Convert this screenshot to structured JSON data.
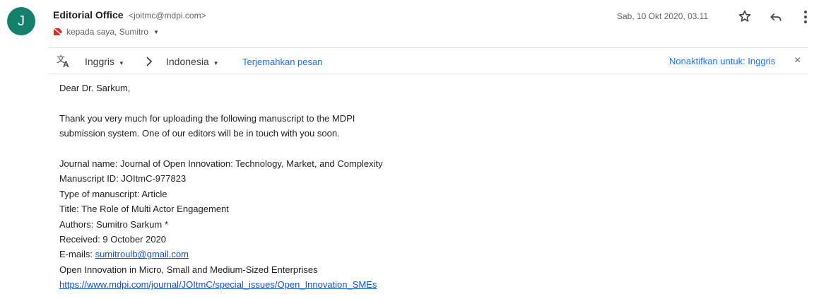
{
  "sender": {
    "avatar_letter": "J",
    "avatar_color": "#12806a",
    "name": "Editorial Office",
    "email": "<joitmc@mdpi.com>",
    "recipients": "kepada saya, Sumitro",
    "label_icon": "label-icon",
    "timestamp": "Sab, 10 Okt 2020, 03.11"
  },
  "actions": {
    "star_icon": "star-icon",
    "reply_icon": "reply-icon",
    "more_icon": "more-vert-icon"
  },
  "translation": {
    "source_lang": "Inggris",
    "target_lang": "Indonesia",
    "translate_link": "Terjemahkan pesan",
    "disable_link": "Nonaktifkan untuk: Inggris",
    "close_glyph": "×",
    "link_color": "#1a73e8"
  },
  "message": {
    "greeting": "Dear Dr. Sarkum,",
    "intro_line1": "Thank you very much for uploading the following manuscript to the MDPI",
    "intro_line2": "submission system. One of our editors will be in touch with you soon.",
    "journal_name": "Journal name: Journal of Open Innovation: Technology, Market, and Complexity",
    "manuscript_id": "Manuscript ID: JOItmC-977823",
    "type": "Type of manuscript: Article",
    "title": "Title: The Role of Multi Actor Engagement",
    "authors": "Authors: Sumitro Sarkum *",
    "received": "Received: 9 October 2020",
    "emails_label": "E-mails:",
    "email_link": "sumitroulb@gmail.com",
    "special_issue": "Open Innovation in Micro, Small and Medium-Sized Enterprises",
    "special_issue_url": "https://www.mdpi.com/journal/JOItmC/special_issues/Open_Innovation_SMEs"
  }
}
